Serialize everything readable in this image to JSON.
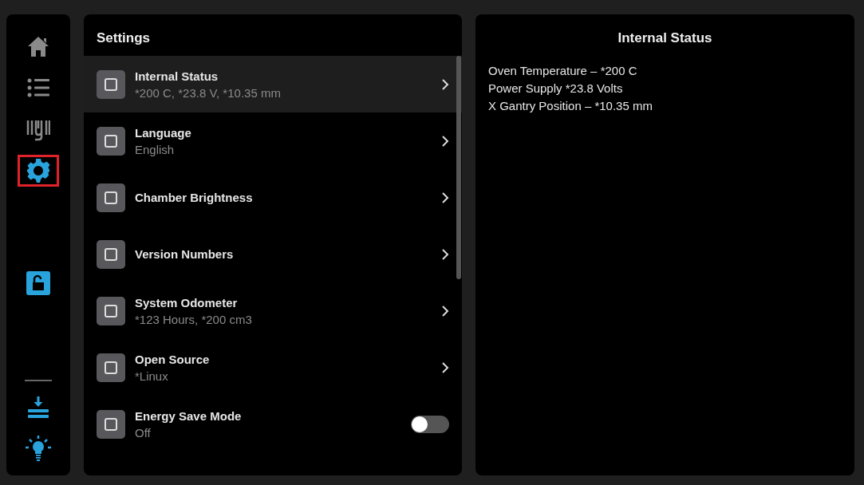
{
  "nav": [
    {
      "kind": "home",
      "selected": false
    },
    {
      "kind": "list",
      "selected": false
    },
    {
      "kind": "filament",
      "selected": false
    },
    {
      "kind": "gear",
      "selected": true
    },
    {
      "kind": "spacer"
    },
    {
      "kind": "lock",
      "selected": false
    },
    {
      "kind": "spacer"
    },
    {
      "kind": "divider"
    },
    {
      "kind": "level",
      "selected": false
    },
    {
      "kind": "bulb",
      "selected": false
    }
  ],
  "settings": {
    "title": "Settings",
    "items": [
      {
        "kind": "link",
        "title": "Internal Status",
        "subtitle": "*200 C, *23.8 V, *10.35 mm",
        "selected": true
      },
      {
        "kind": "link",
        "title": "Language",
        "subtitle": "English",
        "selected": false
      },
      {
        "kind": "link",
        "title": "Chamber Brightness",
        "selected": false
      },
      {
        "kind": "link",
        "title": "Version Numbers",
        "selected": false
      },
      {
        "kind": "link",
        "title": "System Odometer",
        "subtitle": "*123 Hours, *200 cm3",
        "selected": false
      },
      {
        "kind": "link",
        "title": "Open Source",
        "subtitle": "*Linux",
        "selected": false
      },
      {
        "kind": "toggle",
        "title": "Energy Save Mode",
        "subtitle": "Off",
        "selected": false,
        "on": false
      }
    ]
  },
  "detail": {
    "title": "Internal Status",
    "lines": [
      "Oven Temperature – *200 C",
      "Power Supply *23.8 Volts",
      "X Gantry Position – *10.35 mm"
    ]
  }
}
